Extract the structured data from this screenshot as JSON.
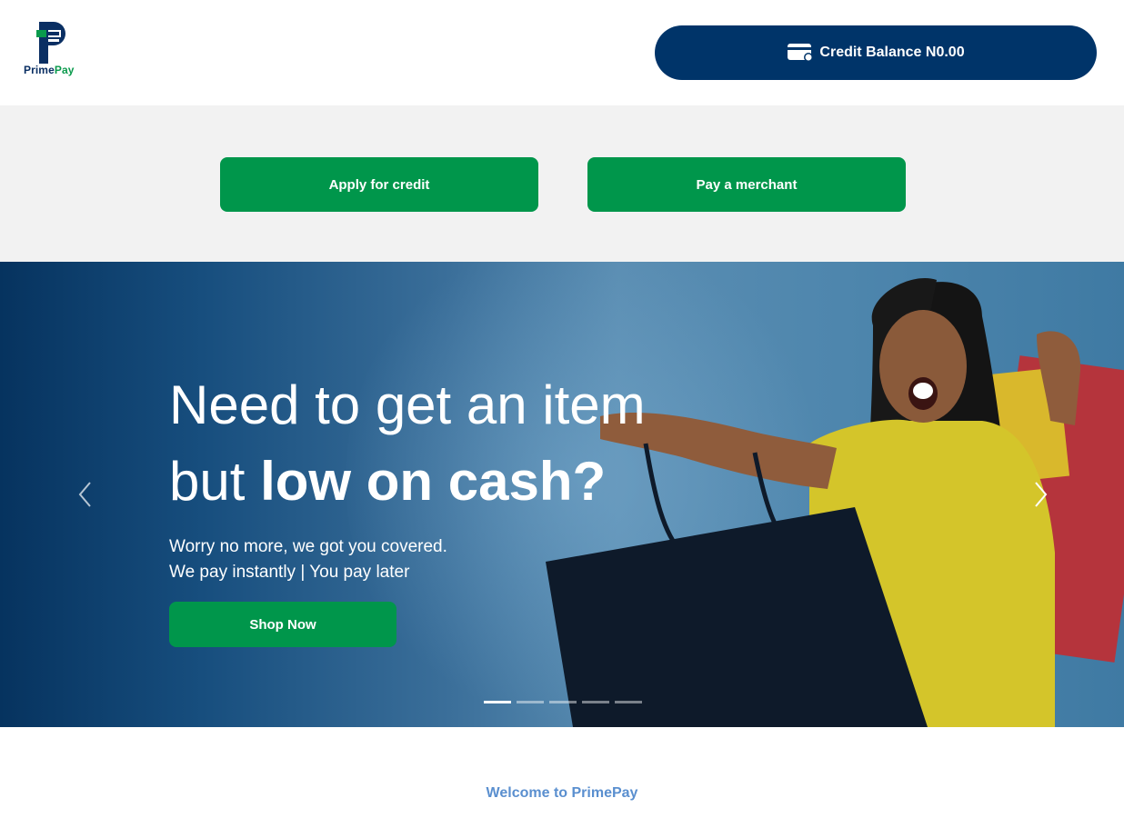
{
  "brand": {
    "name_part1": "Prime",
    "name_part2": "Pay",
    "colors": {
      "navy": "#003469",
      "green": "#00964b",
      "light_bg": "#f2f2f2"
    }
  },
  "header": {
    "credit_balance_label": "Credit Balance N0.00",
    "credit_icon": "credit-card-icon"
  },
  "actions": {
    "apply_label": "Apply for credit",
    "pay_label": "Pay a merchant"
  },
  "hero": {
    "headline_line1": "Need to get an item",
    "headline_line2_regular": "but ",
    "headline_line2_bold": "low on cash?",
    "sub_line1": "Worry no more, we got you covered.",
    "sub_line2": "We pay instantly | You pay later",
    "cta_label": "Shop Now",
    "prev_icon": "chevron-left-icon",
    "next_icon": "chevron-right-icon",
    "slides_count": 5,
    "active_slide": 1
  },
  "welcome": {
    "text": "Welcome to PrimePay"
  }
}
